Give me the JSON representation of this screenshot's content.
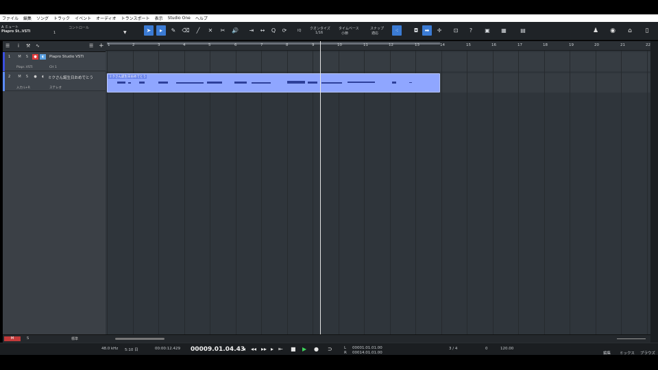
{
  "menu": [
    "ファイル",
    "編集",
    "ソング",
    "トラック",
    "イベント",
    "オーディオ",
    "トランスポート",
    "表示",
    "Studio One",
    "ヘルプ"
  ],
  "toolbar": {
    "mute_label": "ミュート",
    "instrument": "Piapro St..VSTi",
    "control_label": "コントロール",
    "control_value": "1",
    "quantize_label": "クオンタイズ",
    "quantize_value": "1/16",
    "timebase_label": "タイムベース",
    "timebase_value": "小節",
    "snap_label": "スナップ",
    "snap_value": "適応",
    "iq": "IQ"
  },
  "tracks": [
    {
      "num": "1",
      "name": "Piapro Studio VSTi",
      "sub1": "Piapr..VSTi",
      "sub2": "CH 1",
      "color": "#3a4fe0"
    },
    {
      "num": "2",
      "name": "ミクさん誕生日おめでとう",
      "sub1": "入力 L+R",
      "sub2": "ステレオ",
      "color": "#5b8cff"
    }
  ],
  "event_title": "ミクさん誕生日おめでとう",
  "ruler": [
    "1",
    "2",
    "3",
    "4",
    "5",
    "6",
    "7",
    "8",
    "9",
    "10",
    "11",
    "12",
    "13",
    "14",
    "15",
    "16",
    "17",
    "18",
    "19",
    "20",
    "21",
    "22"
  ],
  "bottom": {
    "m": "M",
    "s": "S",
    "mode": "標準"
  },
  "transport": {
    "sample_rate": "48.0 kHz",
    "duration": "5:10 日",
    "time": "00:00:12.429",
    "position": "00009.01.04.43",
    "loop_start": "00001.01.01.00",
    "loop_end": "00014.01.01.00",
    "signature": "3 / 4",
    "count": "0",
    "tempo": "120.00",
    "l": "L",
    "r": "R"
  },
  "right_tabs": [
    "編集",
    "ミックス",
    "ブラウズ"
  ],
  "colors": {
    "accent": "#3b7bd4",
    "event": "#8fa6ff",
    "record": "#e03a3a"
  }
}
